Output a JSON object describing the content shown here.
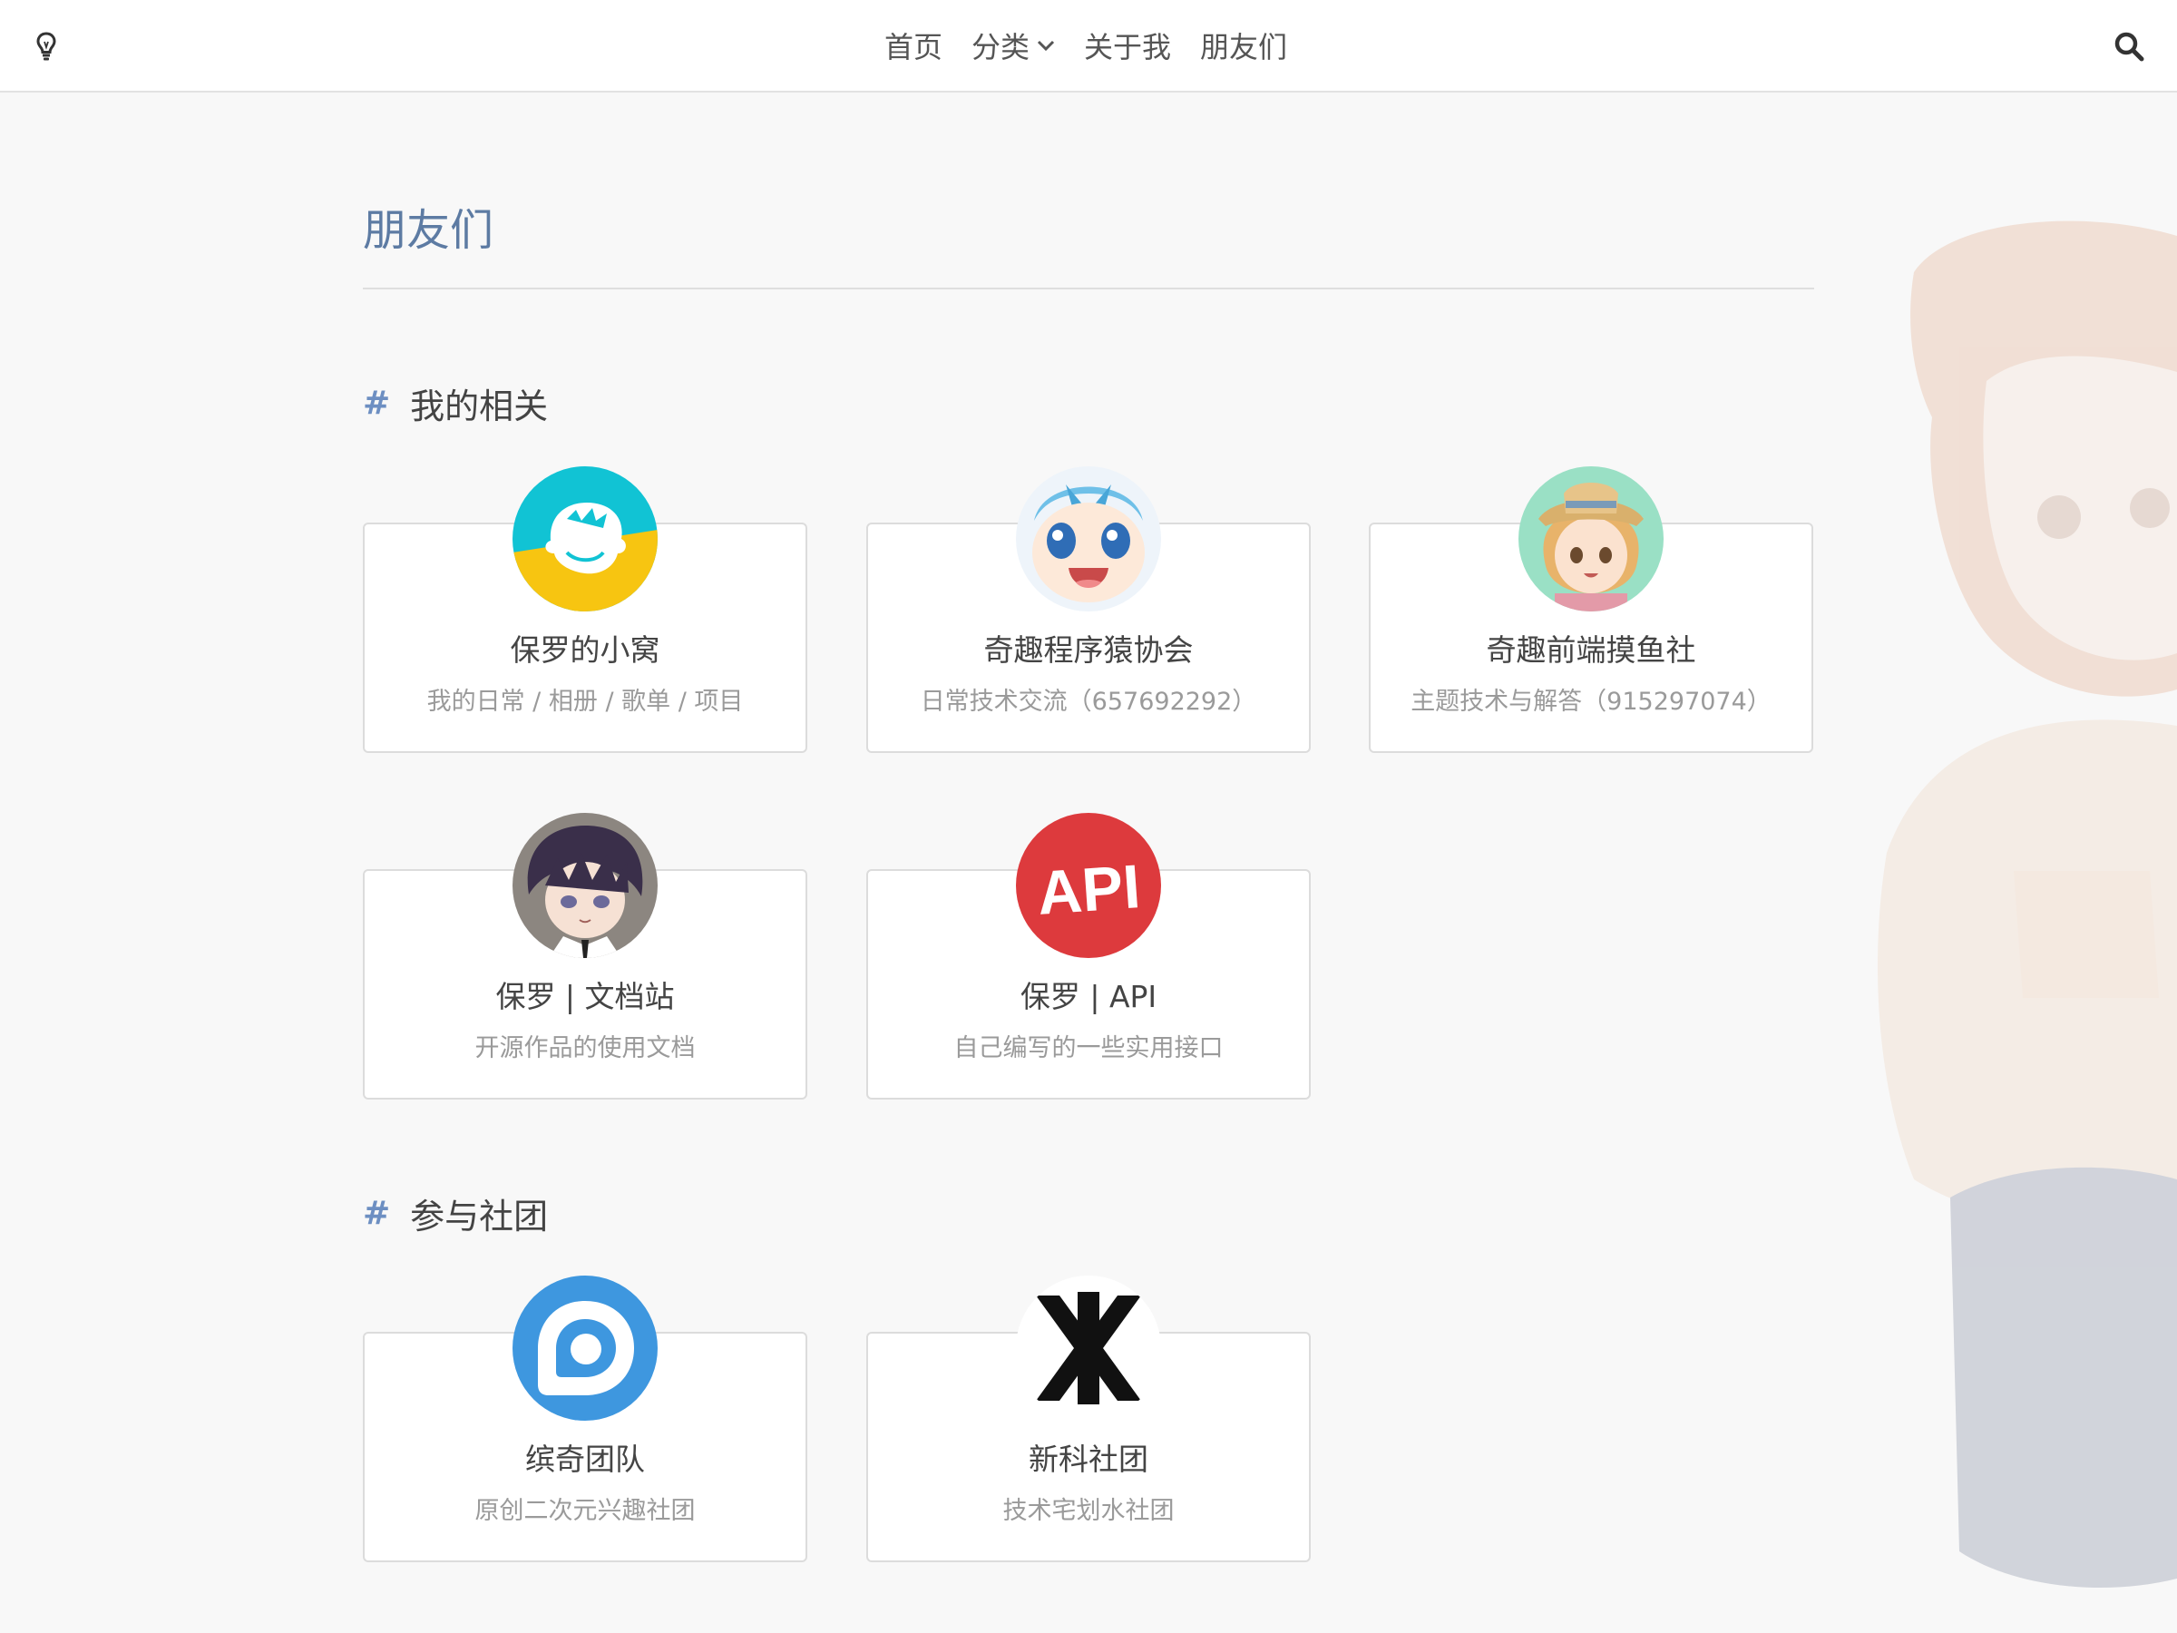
{
  "nav": {
    "items": [
      {
        "label": "首页"
      },
      {
        "label": "分类"
      },
      {
        "label": "关于我"
      },
      {
        "label": "朋友们"
      }
    ]
  },
  "page": {
    "title": "朋友们"
  },
  "sections": [
    {
      "hash": "#",
      "heading": "我的相关",
      "cards": [
        {
          "name": "保罗的小窝",
          "desc": "我的日常 / 相册 / 歌单 / 项目"
        },
        {
          "name": "奇趣程序猿协会",
          "desc": "日常技术交流（657692292）"
        },
        {
          "name": "奇趣前端摸鱼社",
          "desc": "主题技术与解答（915297074）"
        },
        {
          "name": "保罗 | 文档站",
          "desc": "开源作品的使用文档"
        },
        {
          "name": "保罗 | API",
          "desc": "自己编写的一些实用接口"
        }
      ]
    },
    {
      "hash": "#",
      "heading": "参与社团",
      "cards": [
        {
          "name": "缤奇团队",
          "desc": "原创二次元兴趣社团"
        },
        {
          "name": "新科社团",
          "desc": "技术宅划水社团"
        }
      ]
    }
  ],
  "avatar_marks": {
    "api_logo": "API",
    "xinke_logo": "K"
  },
  "colors": {
    "title": "#5d7ba3",
    "hash": "#6d8fc2",
    "border": "#dcdcdc",
    "background": "#f8f8f8"
  },
  "icons": {
    "theme": "lightbulb-icon",
    "search": "search-icon",
    "dropdown": "chevron-down-icon"
  }
}
